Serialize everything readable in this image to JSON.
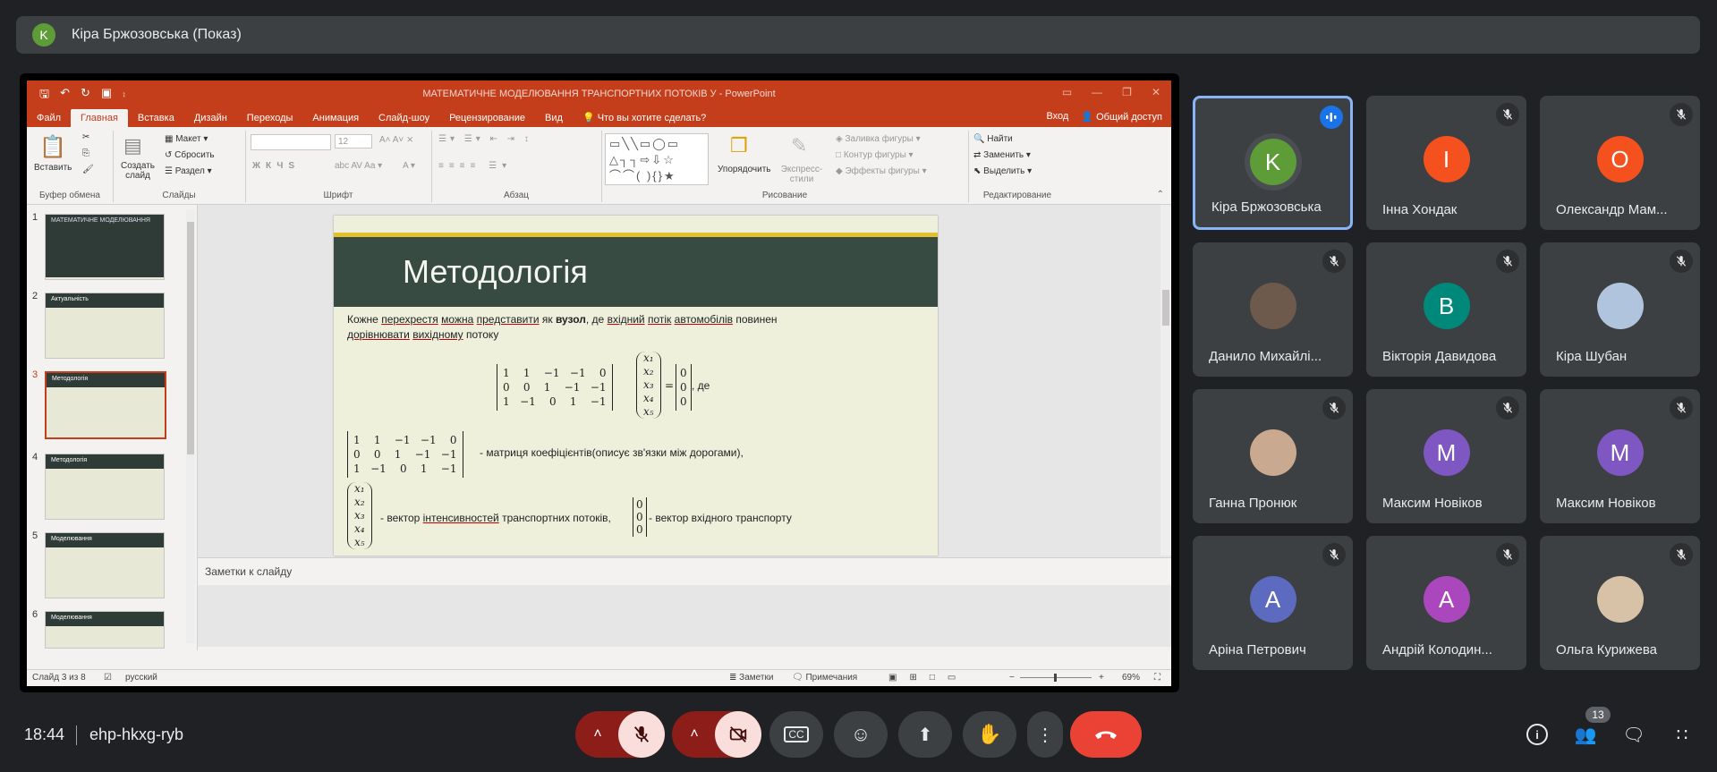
{
  "presenter": {
    "initial": "K",
    "label": "Кіра Бржозовська (Показ)"
  },
  "powerpoint": {
    "title": "МАТЕМАТИЧНЕ МОДЕЛЮВАННЯ ТРАНСПОРТНИХ ПОТОКІВ У - PowerPoint",
    "tabs": [
      "Файл",
      "Главная",
      "Вставка",
      "Дизайн",
      "Переходы",
      "Анимация",
      "Слайд-шоу",
      "Рецензирование",
      "Вид",
      "Что вы хотите сделать?"
    ],
    "login": "Вход",
    "share": "Общий доступ",
    "ribbon": {
      "paste": "Вставить",
      "create_slide": "Создать слайд",
      "layout": "Макет",
      "reset": "Сбросить",
      "section": "Раздел",
      "font_size": "12",
      "arrange": "Упорядочить",
      "quick_styles": "Экспресс-стили",
      "shape_fill": "Заливка фигуры",
      "shape_outline": "Контур фигуры",
      "shape_effects": "Эффекты фигуры",
      "find": "Найти",
      "replace": "Заменить",
      "select": "Выделить",
      "groups": [
        "Буфер обмена",
        "Слайды",
        "Шрифт",
        "Абзац",
        "Рисование",
        "Редактирование"
      ]
    },
    "thumbnails": [
      {
        "num": "1",
        "head": "МАТЕМАТИЧНЕ МОДЕЛЮВАННЯ"
      },
      {
        "num": "2",
        "head": "Актуальність"
      },
      {
        "num": "3",
        "head": "Методологія"
      },
      {
        "num": "4",
        "head": "Методологія"
      },
      {
        "num": "5",
        "head": "Моделювання"
      },
      {
        "num": "6",
        "head": "Моделювання"
      }
    ],
    "slide": {
      "title": "Методологія",
      "line1_a": "Кожне ",
      "line1_b": "перехрестя",
      "line1_c": " ",
      "line1_d": "можна",
      "line1_e": " ",
      "line1_f": "представити",
      "line1_g": " як ",
      "line1_h": "вузол",
      "line1_i": ", де ",
      "line1_j": "вхідний",
      "line1_k": " ",
      "line1_l": "потік",
      "line1_m": " ",
      "line1_n": "автомобілів",
      "line1_o": " повинен",
      "line2_a": "дорівнювати",
      "line2_b": " ",
      "line2_c": "вихідному",
      "line2_d": " потоку",
      "matrix_rows": [
        "1    1    −1   −1    0",
        "0    0    1    −1   −1",
        "1   −1    0    1    −1"
      ],
      "vector_x": [
        "x₁",
        "x₂",
        "x₃",
        "x₄",
        "x₅"
      ],
      "vector_zero": [
        "0",
        "0",
        "0"
      ],
      "de": ", де",
      "eq": "=",
      "coef_text": "- матриця коефіцієнтів(описує зв'язки між дорогами),",
      "vec_text_a": "- вектор ",
      "vec_text_b": "інтенсивностей",
      "vec_text_c": " транспортних потоків,",
      "vec_text_d": "- вектор вхідного транспорту"
    },
    "notes_placeholder": "Заметки к слайду",
    "status": {
      "slide_of": "Слайд 3 из 8",
      "lang": "русский",
      "notes": "Заметки",
      "comments": "Примечания",
      "zoom": "69%"
    }
  },
  "participants": [
    {
      "name": "Кіра Бржозовська",
      "initial": "K",
      "color": "#5e9c37",
      "speaking": true
    },
    {
      "name": "Інна Хондак",
      "initial": "I",
      "color": "#f4511e"
    },
    {
      "name": "Олександр Мам...",
      "initial": "O",
      "color": "#f4511e"
    },
    {
      "name": "Данило Михайлі...",
      "initial": "",
      "color": "#6d5a4c"
    },
    {
      "name": "Вікторія Давидова",
      "initial": "B",
      "color": "#00897b"
    },
    {
      "name": "Кіра Шубан",
      "initial": "",
      "color": "#b0c4de"
    },
    {
      "name": "Ганна Пронюк",
      "initial": "",
      "color": "#c9a98f"
    },
    {
      "name": "Максим Новіков",
      "initial": "M",
      "color": "#7e57c2"
    },
    {
      "name": "Максим Новіков",
      "initial": "M",
      "color": "#7e57c2"
    },
    {
      "name": "Аріна Петрович",
      "initial": "A",
      "color": "#5c6bc0"
    },
    {
      "name": "Андрій Колодин...",
      "initial": "A",
      "color": "#ab47bc"
    },
    {
      "name": "Ольга Курижева",
      "initial": "",
      "color": "#d7c2a8"
    }
  ],
  "meeting": {
    "time": "18:44",
    "code": "ehp-hkxg-ryb",
    "people_count": "13"
  },
  "colors": {
    "end_call": "#ea4335",
    "muted_bg": "#f9dedc",
    "muted_dark": "#8c1d18",
    "accent": "#c43e1c"
  }
}
